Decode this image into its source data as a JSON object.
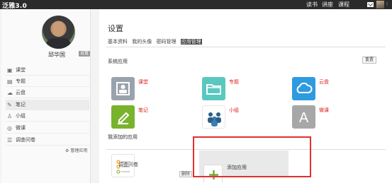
{
  "topbar": {
    "app_title": "泛雅3.0",
    "nav": [
      "读书",
      "讲座",
      "课程"
    ],
    "icons": [
      "envelope-icon",
      "user-avatar"
    ]
  },
  "profile": {
    "name": "邱华国",
    "settings_badge": "设置"
  },
  "sidebar": {
    "items": [
      {
        "label": "课堂",
        "icon": "classroom-icon"
      },
      {
        "label": "专题",
        "icon": "topic-icon"
      },
      {
        "label": "云盘",
        "icon": "cloud-icon"
      },
      {
        "label": "笔记",
        "icon": "note-icon",
        "active": true
      },
      {
        "label": "小组",
        "icon": "group-icon"
      },
      {
        "label": "微课",
        "icon": "microlecture-icon"
      },
      {
        "label": "调查问卷",
        "icon": "survey-icon"
      }
    ],
    "manage_apps": "管理应用"
  },
  "settings": {
    "title": "设置",
    "tabs": [
      "基本资料",
      "我的头像",
      "密码管理",
      "应用管理"
    ],
    "active_tab": "应用管理",
    "system_apps_title": "系统应用",
    "reset_label": "重置",
    "system_apps": [
      {
        "name": "课堂",
        "color": "#9aa3ad"
      },
      {
        "name": "专题",
        "color": "#5bc8c0"
      },
      {
        "name": "云盘",
        "color": "#2e9be0"
      },
      {
        "name": "笔记",
        "color": "#79b32c"
      },
      {
        "name": "小组",
        "color": "#ffffff"
      },
      {
        "name": "微课",
        "color": "#a7a7a7"
      }
    ],
    "my_apps_title": "我添加的应用",
    "my_apps": [
      {
        "name": "调查问卷",
        "delete_label": "删除"
      }
    ],
    "add_app_label": "添加应用"
  },
  "colors": {
    "highlight_box": "#e03030",
    "app_name_text": "#e02020",
    "add_plus": "#7aa336"
  }
}
